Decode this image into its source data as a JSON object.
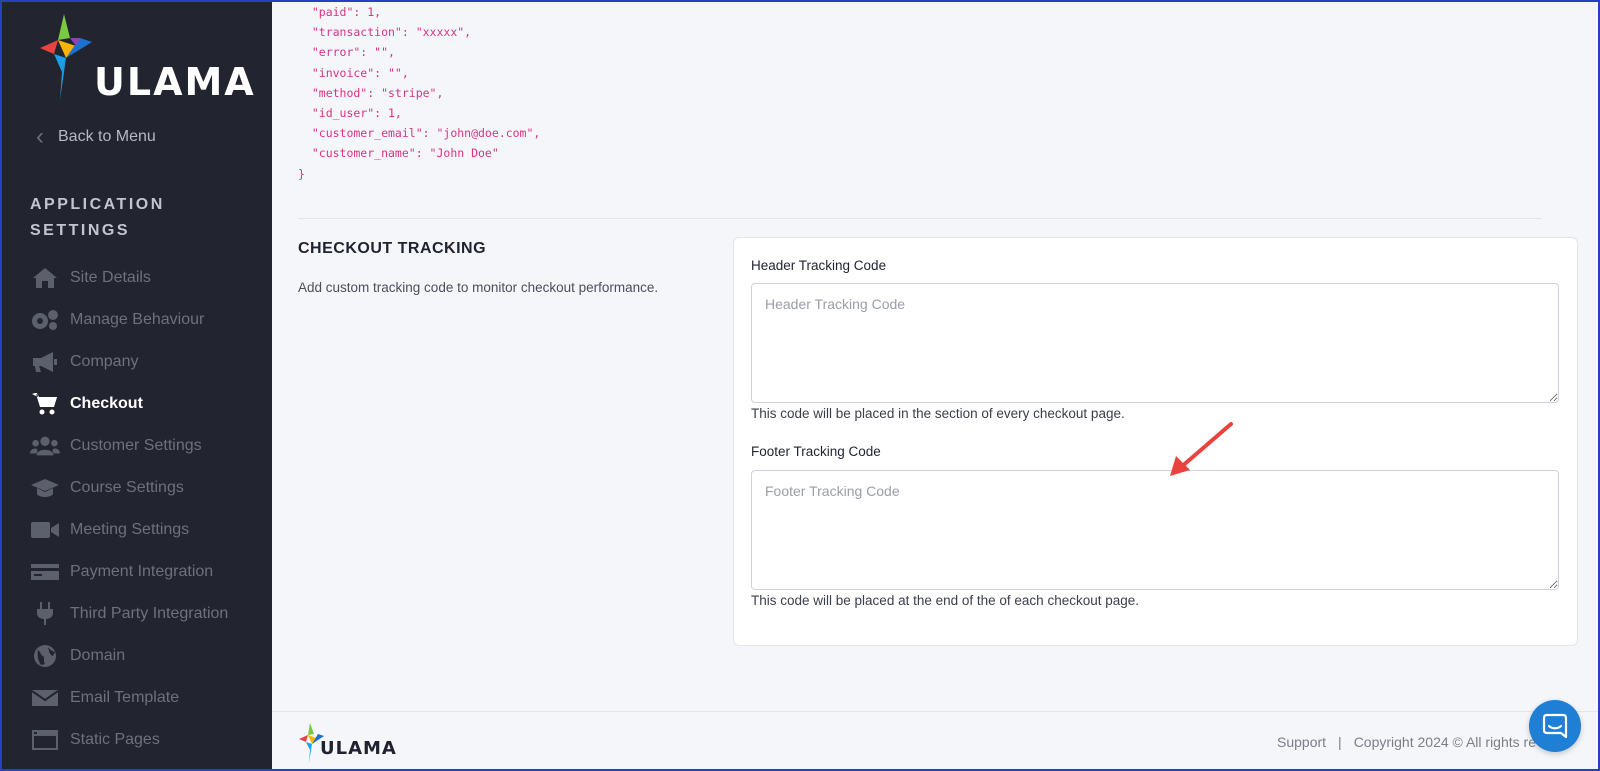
{
  "brand": {
    "name": "ULAMA"
  },
  "sidebar": {
    "back_label": "Back to Menu",
    "section_title": "APPLICATION SETTINGS",
    "items": [
      {
        "label": "Site Details",
        "icon": "home-icon"
      },
      {
        "label": "Manage Behaviour",
        "icon": "gears-icon"
      },
      {
        "label": "Company",
        "icon": "megaphone-icon"
      },
      {
        "label": "Checkout",
        "icon": "cart-icon",
        "active": true
      },
      {
        "label": "Customer Settings",
        "icon": "users-icon"
      },
      {
        "label": "Course Settings",
        "icon": "graduation-cap-icon"
      },
      {
        "label": "Meeting Settings",
        "icon": "video-icon"
      },
      {
        "label": "Payment Integration",
        "icon": "credit-card-icon"
      },
      {
        "label": "Third Party Integration",
        "icon": "plug-icon"
      },
      {
        "label": "Domain",
        "icon": "globe-icon"
      },
      {
        "label": "Email Template",
        "icon": "envelope-icon"
      },
      {
        "label": "Static Pages",
        "icon": "window-icon"
      }
    ]
  },
  "json_snippet": "  \"paid\": 1,\n  \"transaction\": \"xxxxx\",\n  \"error\": \"\",\n  \"invoice\": \"\",\n  \"method\": \"stripe\",\n  \"id_user\": 1,\n  \"customer_email\": \"john@doe.com\",\n  \"customer_name\": \"John Doe\"\n}",
  "checkout_tracking": {
    "title": "CHECKOUT TRACKING",
    "description": "Add custom tracking code to monitor checkout performance.",
    "header": {
      "label": "Header Tracking Code",
      "value": "",
      "placeholder": "Header Tracking Code",
      "help": "This code will be placed in the section of every checkout page."
    },
    "footer": {
      "label": "Footer Tracking Code",
      "value": "",
      "placeholder": "Footer Tracking Code",
      "help": "This code will be placed at the end of the of each checkout page."
    }
  },
  "footer": {
    "support": "Support",
    "separator": "|",
    "copyright": "Copyright 2024 © All rights re"
  },
  "colors": {
    "sidebar_bg": "#22252f",
    "accent_pink": "#d63384",
    "chat_blue": "#1f7fd4",
    "arrow_red": "#e8433f"
  }
}
